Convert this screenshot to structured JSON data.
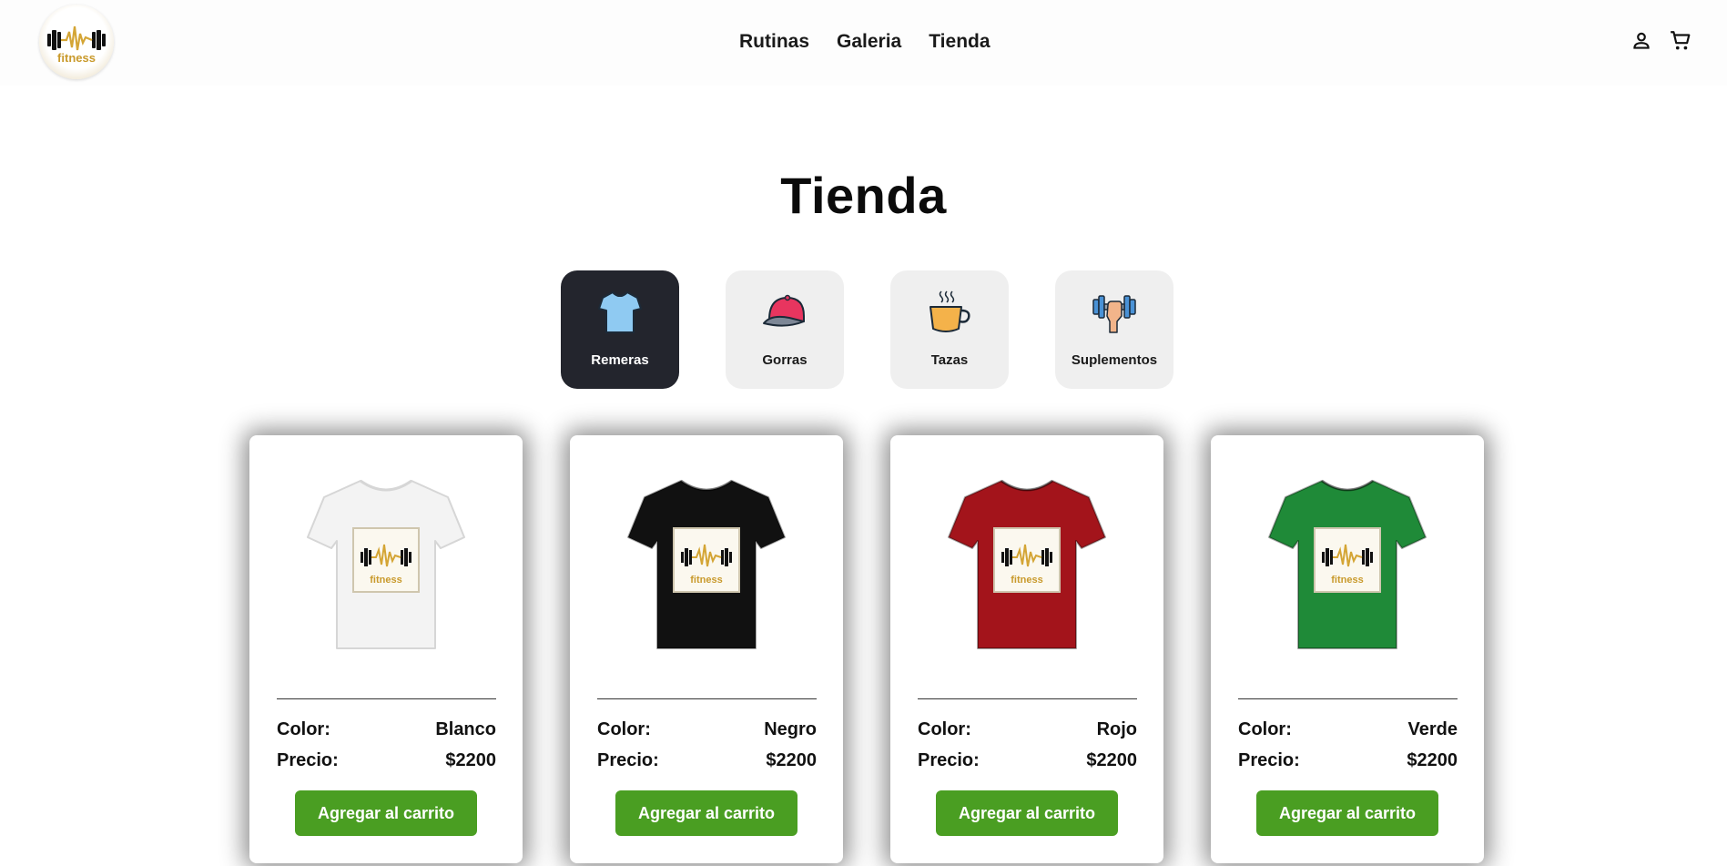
{
  "header": {
    "logo_text": "fitness",
    "nav": [
      "Rutinas",
      "Galeria",
      "Tienda"
    ],
    "icons": [
      "user-icon",
      "cart-icon"
    ]
  },
  "page_title": "Tienda",
  "categories": [
    {
      "label": "Remeras",
      "icon": "tshirt-icon",
      "active": true
    },
    {
      "label": "Gorras",
      "icon": "cap-icon",
      "active": false
    },
    {
      "label": "Tazas",
      "icon": "mug-icon",
      "active": false
    },
    {
      "label": "Suplementos",
      "icon": "dumbbell-icon",
      "active": false
    }
  ],
  "products": [
    {
      "color_label": "Color:",
      "color_value": "Blanco",
      "price_label": "Precio:",
      "price_value": "$2200",
      "button": "Agregar al carrito",
      "shirt_color": "#f3f3f3"
    },
    {
      "color_label": "Color:",
      "color_value": "Negro",
      "price_label": "Precio:",
      "price_value": "$2200",
      "button": "Agregar al carrito",
      "shirt_color": "#111111"
    },
    {
      "color_label": "Color:",
      "color_value": "Rojo",
      "price_label": "Precio:",
      "price_value": "$2200",
      "button": "Agregar al carrito",
      "shirt_color": "#a3141b"
    },
    {
      "color_label": "Color:",
      "color_value": "Verde",
      "price_label": "Precio:",
      "price_value": "$2200",
      "button": "Agregar al carrito",
      "shirt_color": "#1f8a38"
    }
  ],
  "colors": {
    "button_green": "#4a9e22",
    "active_category": "#23252d",
    "inactive_category": "#efefef",
    "logo_gold": "#d4a535"
  }
}
